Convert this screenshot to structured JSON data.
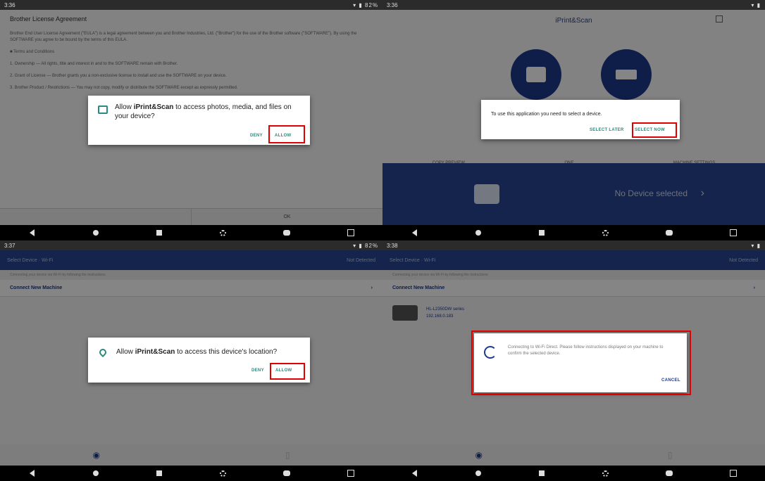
{
  "panel1": {
    "status_time": "3:36",
    "status_icons": "▾ ▮ 82%",
    "title": "Brother License Agreement",
    "paragraphs": [
      "Brother End User License Agreement (\"EULA\") is a legal agreement between you and Brother Industries, Ltd. (\"Brother\") for the use of the Brother software (\"SOFTWARE\"). By using the SOFTWARE you agree to be bound by the terms of this EULA.",
      "■ Terms and Conditions",
      "1. Ownership — All rights, title and interest in and to the SOFTWARE remain with Brother.",
      "2. Grant of License — Brother grants you a non-exclusive license to install and use the SOFTWARE on your device.",
      "3. Brother Product / Restrictions — You may not copy, modify or distribute the SOFTWARE except as expressly permitted."
    ],
    "bottom_left": "",
    "bottom_right": "OK",
    "dialog_text_pre": "Allow ",
    "dialog_app": "iPrint&Scan",
    "dialog_text_post": " to access photos, media, and files on your device?",
    "deny": "DENY",
    "allow": "ALLOW"
  },
  "panel2": {
    "status_time": "3:36",
    "status_icons": "▾ ▮",
    "app_title": "iPrint&Scan",
    "labels": [
      "COPY PREVIEW",
      "ONE",
      "MACHINE SETTINGS"
    ],
    "no_device": "No Device selected",
    "dialog_text": "To use this application you need to select a device.",
    "select_later": "SELECT LATER",
    "select_now": "SELECT NOW"
  },
  "panel3": {
    "status_time": "3:37",
    "status_icons": "▾ ▮ 82%",
    "bar_left": "Select Device · Wi-Fi",
    "bar_right": "Not Detected",
    "subline": "Connecting your device via Wi-Fi by following the instructions",
    "section": "Connect New Machine",
    "dialog_text_pre": "Allow ",
    "dialog_app": "iPrint&Scan",
    "dialog_text_post": " to access this device's location?",
    "deny": "DENY",
    "allow": "ALLOW"
  },
  "panel4": {
    "status_time": "3:38",
    "status_icons": "▾ ▮",
    "bar_left": "Select Device · Wi-Fi",
    "bar_right": "Not Detected",
    "subline": "Connecting your device via Wi-Fi by following the instructions",
    "section": "Connect New Machine",
    "device_name": "HL-L2350DW series",
    "device_ip": "192.168.0.183",
    "dialog_text": "Connecting to Wi-Fi Direct. Please follow instructions displayed on your machine to confirm the selected device.",
    "cancel": "CANCEL"
  }
}
